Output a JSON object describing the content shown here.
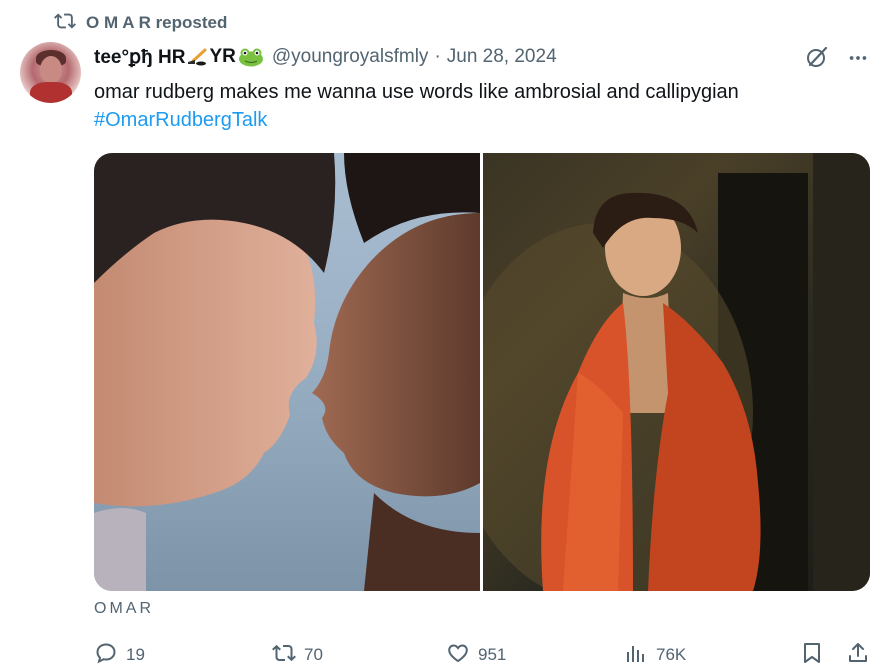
{
  "repost": {
    "text": "O M A R reposted",
    "icon": "repost-icon"
  },
  "tweet": {
    "display_name_prefix": "tee°ꝑђ HR",
    "display_name_mid": "YR",
    "emoji": [
      "hockey-stick-emoji",
      "frog-emoji"
    ],
    "handle": "@youngroyalsfmly",
    "separator": "·",
    "date": "Jun 28, 2024",
    "text": "omar rudberg makes me wanna use words like ambrosial and callipygian",
    "hashtag": "#OmarRudbergTalk"
  },
  "media": {
    "count": 2,
    "images": [
      "two-men-faces-close-photo",
      "man-red-leather-jacket-photo"
    ],
    "caption": "OMAR"
  },
  "actions": {
    "replies": "19",
    "reposts": "70",
    "likes": "951",
    "views": "76K"
  },
  "colors": {
    "accent": "#1d9bf0",
    "secondary_text": "#536471",
    "primary_text": "#0f1419"
  }
}
